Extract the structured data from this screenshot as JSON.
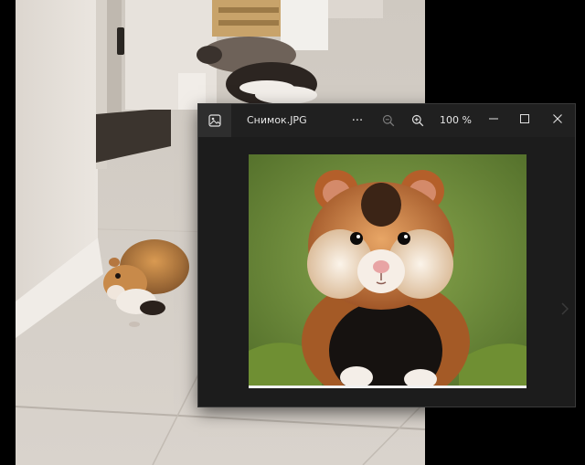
{
  "window": {
    "title": "Снимок.JPG",
    "more_label": "···",
    "zoom_level": "100 %",
    "app_icon": "image-icon",
    "icons": {
      "zoom_out": "zoom-out-icon",
      "zoom_in": "zoom-in-icon",
      "minimize": "minimize-icon",
      "maximize": "maximize-icon",
      "close": "close-icon",
      "next": "chevron-right-icon"
    }
  },
  "colors": {
    "window_bg": "#202020",
    "text": "#e6e6e6",
    "desktop_bg": "#000000"
  }
}
